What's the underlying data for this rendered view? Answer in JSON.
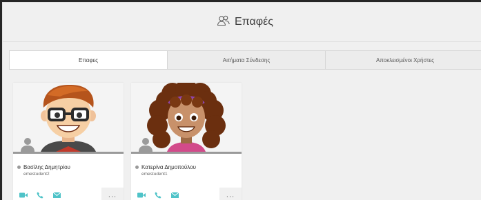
{
  "header": {
    "title": "Επαφές",
    "icon": "contacts-icon"
  },
  "tabs": [
    {
      "label": "Επαφες",
      "active": true
    },
    {
      "label": "Αιτήματα Σύνδεσης",
      "active": false
    },
    {
      "label": "Αποκλεισμένοι Χρήστες",
      "active": false
    }
  ],
  "contacts": [
    {
      "name": "Βασίλης Δημητρίου",
      "username": "emestudent2",
      "status_color": "#9a9a9a"
    },
    {
      "name": "Κατερίνα Δημοπούλου",
      "username": "emestudent1",
      "status_color": "#9a9a9a"
    }
  ],
  "actions": {
    "video_icon": "video-icon",
    "phone_icon": "phone-icon",
    "mail_icon": "mail-icon",
    "more_label": "..."
  },
  "colors": {
    "action_accent": "#4fc3c8",
    "frame_bg": "#f0f0f0",
    "border": "#262626"
  }
}
